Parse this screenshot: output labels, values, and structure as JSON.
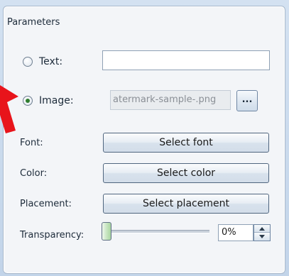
{
  "parameters": {
    "group_title": "Parameters",
    "text_option": {
      "label": "Text:",
      "selected": false,
      "value": ""
    },
    "image_option": {
      "label": "Image:",
      "selected": true,
      "value": "atermark-sample-.png"
    },
    "browse_label": "...",
    "font": {
      "label": "Font:",
      "button": "Select font"
    },
    "color": {
      "label": "Color:",
      "button": "Select color"
    },
    "placement": {
      "label": "Placement:",
      "button": "Select placement"
    },
    "transparency": {
      "label": "Transparency:",
      "value": "0%",
      "level": 0
    }
  },
  "annotation": {
    "pointer_color": "#e8141b",
    "icon": "red-arrow-icon"
  }
}
